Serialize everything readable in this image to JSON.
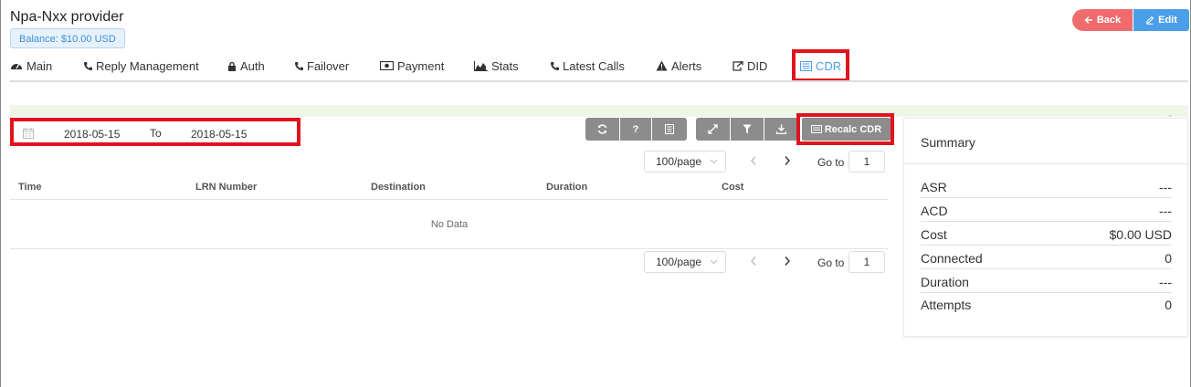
{
  "header": {
    "title": "Npa-Nxx provider",
    "balance": "Balance: $10.00 USD",
    "back_label": "Back",
    "edit_label": "Edit"
  },
  "tabs": [
    {
      "label": "Main",
      "icon": "dashboard-icon"
    },
    {
      "label": "Reply Management",
      "icon": "phone-icon"
    },
    {
      "label": "Auth",
      "icon": "lock-icon"
    },
    {
      "label": "Failover",
      "icon": "phone-icon"
    },
    {
      "label": "Payment",
      "icon": "money-icon"
    },
    {
      "label": "Stats",
      "icon": "area-chart-icon"
    },
    {
      "label": "Latest Calls",
      "icon": "phone-icon"
    },
    {
      "label": "Alerts",
      "icon": "warning-icon"
    },
    {
      "label": "DID",
      "icon": "share-icon"
    },
    {
      "label": "CDR",
      "icon": "list-icon",
      "active": true
    }
  ],
  "filter": {
    "date_from": "2018-05-15",
    "to_label": "To",
    "date_to": "2018-05-15"
  },
  "toolbar": {
    "help_label": "?",
    "recalc_label": "Recalc CDR"
  },
  "pager": {
    "page_size": "100/page",
    "goto_label": "Go to",
    "page": "1"
  },
  "table": {
    "columns": [
      "Time",
      "LRN Number",
      "Destination",
      "Duration",
      "Cost"
    ],
    "empty_text": "No Data"
  },
  "summary": {
    "title": "Summary",
    "rows": [
      {
        "label": "ASR",
        "value": "---"
      },
      {
        "label": "ACD",
        "value": "---"
      },
      {
        "label": "Cost",
        "value": "$0.00 USD"
      },
      {
        "label": "Connected",
        "value": "0"
      },
      {
        "label": "Duration",
        "value": "---"
      },
      {
        "label": "Attempts",
        "value": "0"
      }
    ]
  },
  "colors": {
    "accent": "#4a9fe8",
    "danger": "#f06b6b",
    "toolbar_gray": "#8c8c8c",
    "highlight_red": "#e0141c"
  }
}
